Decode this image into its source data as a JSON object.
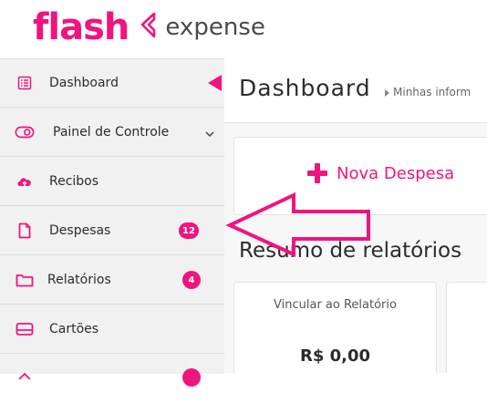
{
  "app": {
    "logo_flash": "flash",
    "logo_expense": "expense"
  },
  "sidebar": {
    "items": [
      {
        "label": "Dashboard",
        "icon": "dashboard-list-icon",
        "active": true
      },
      {
        "label": "Painel de Controle",
        "icon": "toggle-icon",
        "expandable": true
      },
      {
        "label": "Recibos",
        "icon": "cloud-upload-icon"
      },
      {
        "label": "Despesas",
        "icon": "document-icon",
        "badge": "12"
      },
      {
        "label": "Relatórios",
        "icon": "folder-icon",
        "badge": "4"
      },
      {
        "label": "Cartões",
        "icon": "card-icon"
      }
    ]
  },
  "main": {
    "title": "Dashboard",
    "breadcrumb": "Minhas inform",
    "new_expense_label": "Nova Despesa",
    "section_title": "Resumo de relatórios",
    "cards": [
      {
        "label": "Vincular ao Relatório",
        "value": "R$ 0,00"
      }
    ]
  },
  "colors": {
    "brand": "#f0147f",
    "sidebar_bg": "#f1f1f1",
    "annotation_arrow": "#f0147f"
  }
}
